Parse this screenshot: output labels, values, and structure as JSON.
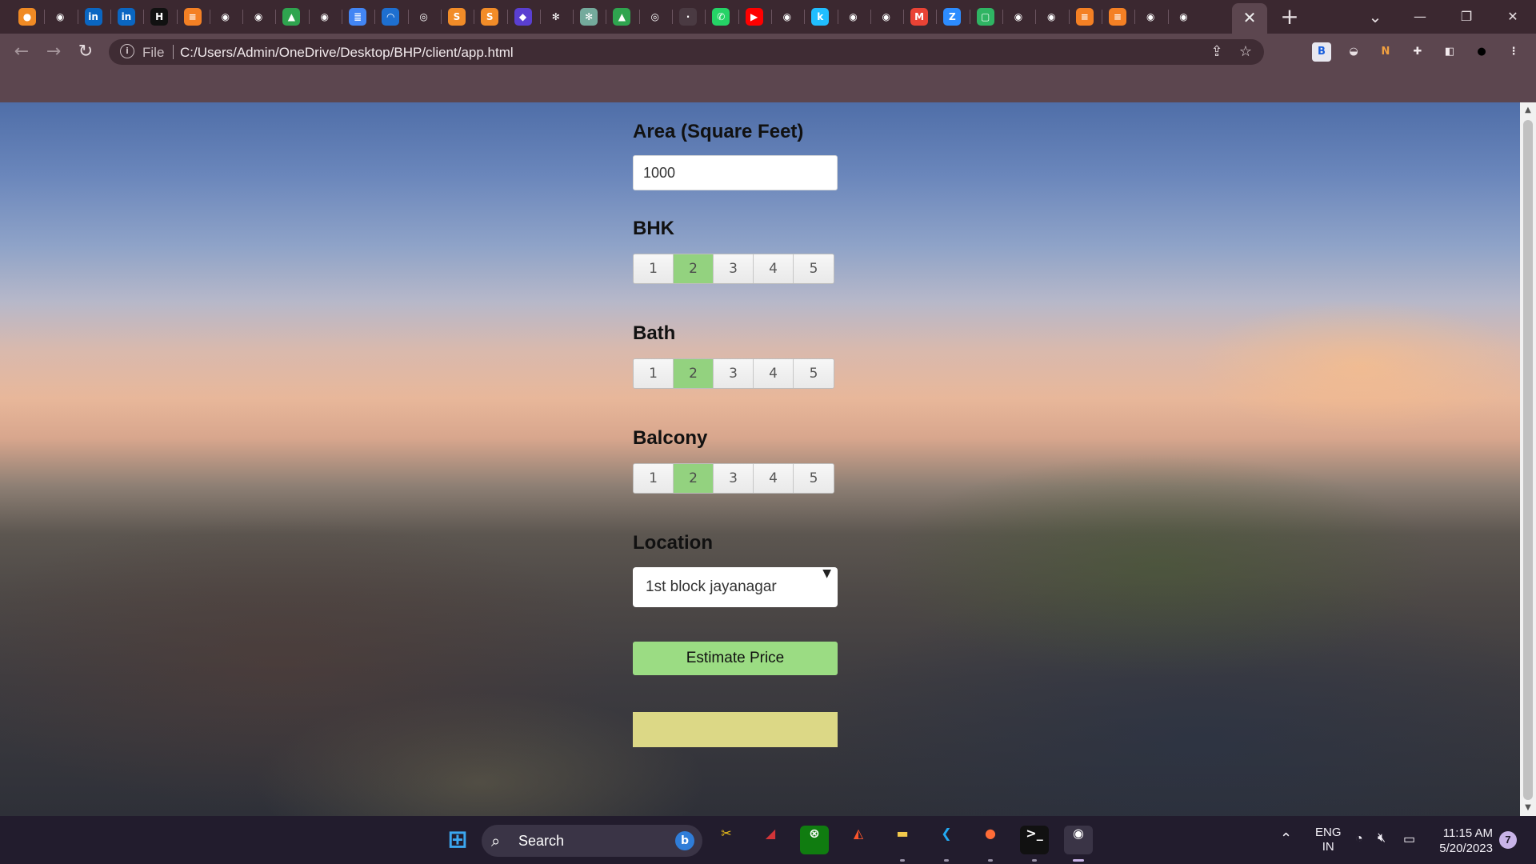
{
  "browser": {
    "active_tab_close": "✕",
    "new_tab": "+",
    "tab_list": "⌄",
    "window": {
      "minimize": "—",
      "restore": "❐",
      "close": "✕"
    },
    "back": "←",
    "forward": "→",
    "reload": "↻",
    "address": {
      "scheme_label": "File",
      "url": "C:/Users/Admin/OneDrive/Desktop/BHP/client/app.html"
    },
    "tab_icons": [
      {
        "name": "firefox-icon",
        "glyph": "●",
        "color": "#f08a24"
      },
      {
        "name": "github-icon",
        "glyph": "◉",
        "color": "#3b2830"
      },
      {
        "name": "linkedin-icon",
        "glyph": "in",
        "color": "#0a66c2"
      },
      {
        "name": "linkedin-icon",
        "glyph": "in",
        "color": "#0a66c2"
      },
      {
        "name": "hackerrank-icon",
        "glyph": "H",
        "color": "#111111"
      },
      {
        "name": "stackoverflow-icon",
        "glyph": "≡",
        "color": "#f48024"
      },
      {
        "name": "github-icon",
        "glyph": "◉",
        "color": "#3b2830"
      },
      {
        "name": "github-icon",
        "glyph": "◉",
        "color": "#3b2830"
      },
      {
        "name": "google-drive-icon",
        "glyph": "▲",
        "color": "#2fa44f"
      },
      {
        "name": "github-icon",
        "glyph": "◉",
        "color": "#3b2830"
      },
      {
        "name": "google-docs-icon",
        "glyph": "≣",
        "color": "#4285f4"
      },
      {
        "name": "edge-icon",
        "glyph": "◠",
        "color": "#1e6fd0"
      },
      {
        "name": "globe-icon",
        "glyph": "◎",
        "color": "#3b2830"
      },
      {
        "name": "sublime-icon",
        "glyph": "S",
        "color": "#f28c28"
      },
      {
        "name": "sublime-icon",
        "glyph": "S",
        "color": "#f28c28"
      },
      {
        "name": "shield-icon",
        "glyph": "◆",
        "color": "#5a3fd1"
      },
      {
        "name": "chatgpt-icon",
        "glyph": "✻",
        "color": "#3b2830"
      },
      {
        "name": "chatgpt-icon",
        "glyph": "✻",
        "color": "#74aa9c"
      },
      {
        "name": "google-drive-icon",
        "glyph": "▲",
        "color": "#2fa44f"
      },
      {
        "name": "globe-icon",
        "glyph": "◎",
        "color": "#3b2830"
      },
      {
        "name": "blank-page-icon",
        "glyph": "·",
        "color": "#4a3a42"
      },
      {
        "name": "whatsapp-icon",
        "glyph": "✆",
        "color": "#25d366"
      },
      {
        "name": "youtube-icon",
        "glyph": "▶",
        "color": "#ff0000"
      },
      {
        "name": "github-icon",
        "glyph": "◉",
        "color": "#3b2830"
      },
      {
        "name": "kaggle-icon",
        "glyph": "k",
        "color": "#20beff"
      },
      {
        "name": "github-icon",
        "glyph": "◉",
        "color": "#3b2830"
      },
      {
        "name": "github-icon",
        "glyph": "◉",
        "color": "#3b2830"
      },
      {
        "name": "gmail-icon",
        "glyph": "M",
        "color": "#ea4335"
      },
      {
        "name": "zoom-icon",
        "glyph": "Z",
        "color": "#2d8cff"
      },
      {
        "name": "screen-icon",
        "glyph": "▢",
        "color": "#2fb463"
      },
      {
        "name": "github-icon",
        "glyph": "◉",
        "color": "#3b2830"
      },
      {
        "name": "github-icon",
        "glyph": "◉",
        "color": "#3b2830"
      },
      {
        "name": "stackoverflow-icon",
        "glyph": "≡",
        "color": "#f48024"
      },
      {
        "name": "stackoverflow-icon",
        "glyph": "≡",
        "color": "#f48024"
      },
      {
        "name": "chrome-icon",
        "glyph": "◉",
        "color": "#3b2830"
      },
      {
        "name": "chrome-icon",
        "glyph": "◉",
        "color": "#3b2830"
      }
    ],
    "extensions": [
      {
        "name": "bitwarden-icon",
        "glyph": "B",
        "bg": "#e8e8f0",
        "fg": "#175ddc"
      },
      {
        "name": "mask-extension-icon",
        "glyph": "◒",
        "bg": "#5c464f",
        "fg": "#e8e0e3"
      },
      {
        "name": "notion-icon",
        "glyph": "N",
        "bg": "#5c464f",
        "fg": "#f0a040"
      },
      {
        "name": "puzzle-icon",
        "glyph": "✚",
        "bg": "#5c464f",
        "fg": "#f2eaed"
      },
      {
        "name": "sidepanel-icon",
        "glyph": "◧",
        "bg": "#5c464f",
        "fg": "#f2eaed"
      },
      {
        "name": "profile-avatar-icon",
        "glyph": "●",
        "bg": "#5c464f",
        "fg": "#000000"
      },
      {
        "name": "kebab-menu-icon",
        "glyph": "⋮",
        "bg": "#5c464f",
        "fg": "#f2eaed"
      }
    ]
  },
  "form": {
    "area_label": "Area (Square Feet)",
    "area_value": "1000",
    "bhk_label": "BHK",
    "bath_label": "Bath",
    "balcony_label": "Balcony",
    "options": [
      "1",
      "2",
      "3",
      "4",
      "5"
    ],
    "bhk_selected": "2",
    "bath_selected": "2",
    "balcony_selected": "2",
    "location_label": "Location",
    "location_selected": "1st block jayanagar",
    "estimate_button": "Estimate Price",
    "result_text": ""
  },
  "taskbar": {
    "search_placeholder": "Search",
    "tray_language": "ENG",
    "tray_region": "IN",
    "time": "11:15 AM",
    "date": "5/20/2023",
    "notification_count": "7",
    "apps": [
      {
        "name": "start-icon",
        "glyph": "⊞",
        "color": "#3ba7f0",
        "bg": "transparent"
      },
      {
        "name": "snipping-tool-icon",
        "glyph": "✂",
        "color": "#f5c518",
        "bg": "transparent"
      },
      {
        "name": "app-red-icon",
        "glyph": "◢",
        "color": "#d13438",
        "bg": "transparent"
      },
      {
        "name": "xbox-icon",
        "glyph": "⊗",
        "color": "#ffffff",
        "bg": "#107c10"
      },
      {
        "name": "brave-icon",
        "glyph": "◭",
        "color": "#fb542b",
        "bg": "transparent"
      },
      {
        "name": "file-explorer-icon",
        "glyph": "▬",
        "color": "#f2c94c",
        "bg": "transparent"
      },
      {
        "name": "vscode-icon",
        "glyph": "❮",
        "color": "#23a9f2",
        "bg": "transparent"
      },
      {
        "name": "postman-icon",
        "glyph": "●",
        "color": "#ff6c37",
        "bg": "transparent"
      },
      {
        "name": "terminal-icon",
        "glyph": ">_",
        "color": "#ffffff",
        "bg": "#111111"
      },
      {
        "name": "chrome-icon",
        "glyph": "◉",
        "color": "#ffffff",
        "bg": "#3a3446"
      }
    ]
  }
}
